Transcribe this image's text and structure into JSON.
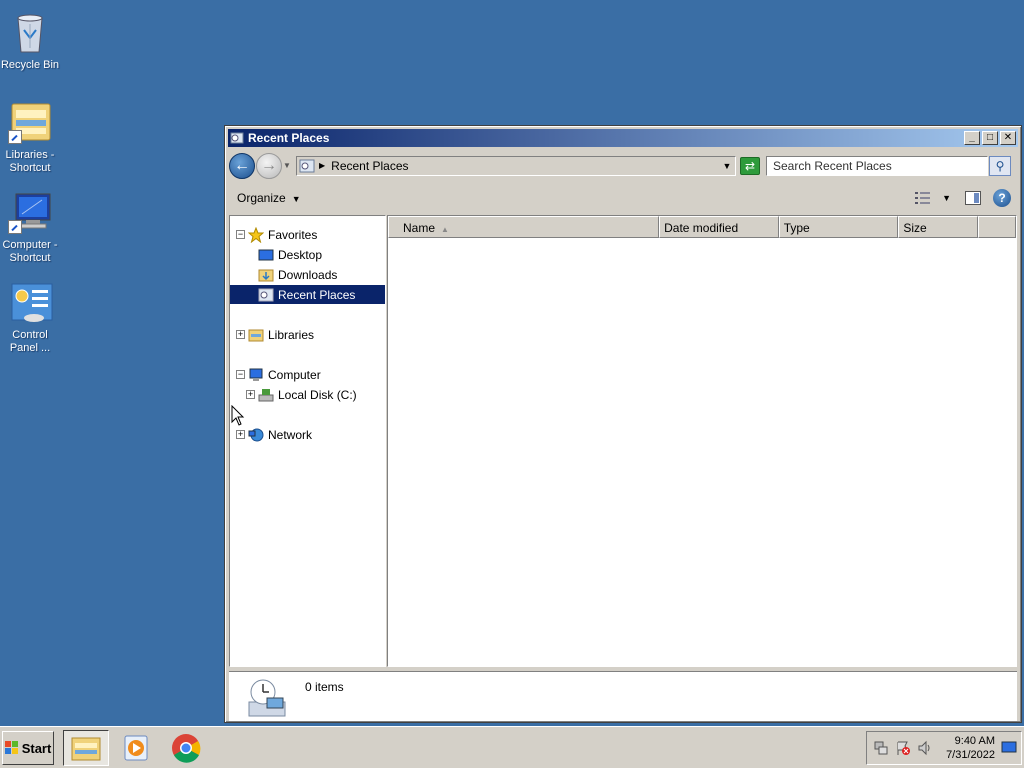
{
  "desktop": {
    "icons": [
      {
        "label": "Recycle Bin",
        "icon": "recycle-bin-icon"
      },
      {
        "label": "Libraries - Shortcut",
        "icon": "libraries-icon"
      },
      {
        "label": "Computer - Shortcut",
        "icon": "computer-icon"
      },
      {
        "label": "Control Panel ...",
        "icon": "control-panel-icon"
      }
    ]
  },
  "window": {
    "title": "Recent Places",
    "controls": {
      "minimize": "_",
      "maximize": "□",
      "close": "✕"
    },
    "address": "Recent Places",
    "search_placeholder": "Search Recent Places",
    "organize_label": "Organize",
    "nav": {
      "favorites": "Favorites",
      "desktop": "Desktop",
      "downloads": "Downloads",
      "recent_places": "Recent Places",
      "libraries": "Libraries",
      "computer": "Computer",
      "local_disk": "Local Disk (C:)",
      "network": "Network"
    },
    "columns": [
      "Name",
      "Date modified",
      "Type",
      "Size"
    ],
    "status": "0 items"
  },
  "taskbar": {
    "start_label": "Start",
    "apps": [
      "file-explorer-icon",
      "media-player-icon",
      "chrome-icon"
    ],
    "time": "9:40 AM",
    "date": "7/31/2022"
  },
  "colors": {
    "desktop": "#3a6ea5",
    "title_active": "#0a246a",
    "selection": "#0a246a",
    "chrome": "#d4d0c8"
  }
}
